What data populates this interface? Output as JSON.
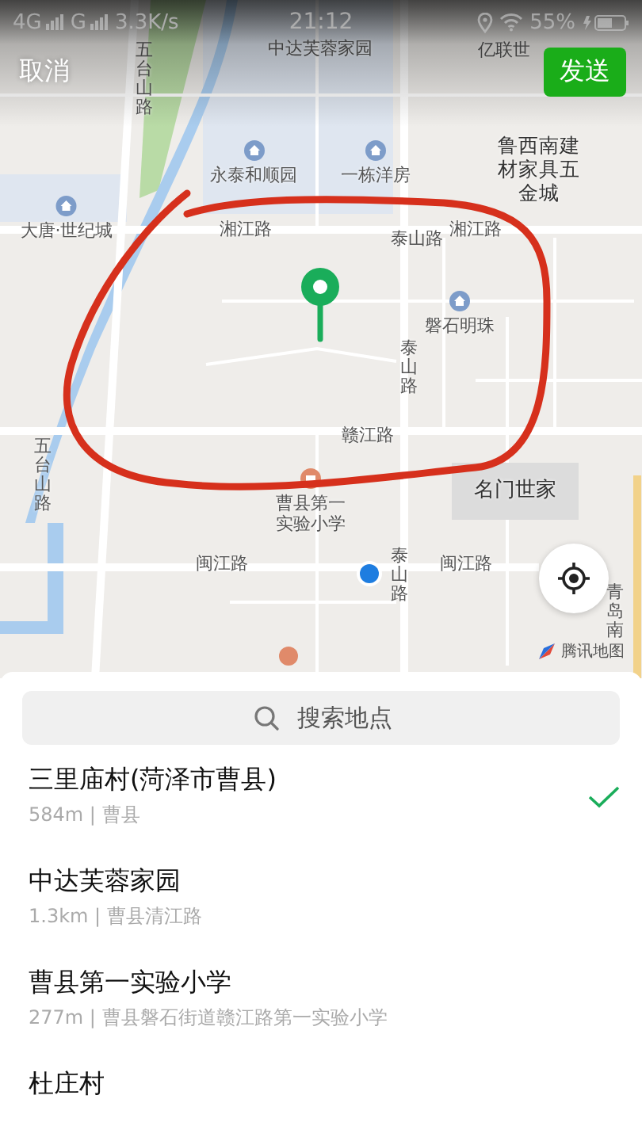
{
  "status_bar": {
    "network_1": "4G",
    "network_2": "G",
    "speed": "3.3K/s",
    "time": "21:12",
    "battery": "55%"
  },
  "top_bar": {
    "cancel": "取消",
    "send": "发送"
  },
  "map": {
    "labels": [
      {
        "text": "五台山路",
        "kind": "vroad"
      },
      {
        "text": "中达芙蓉家园",
        "kind": "road"
      },
      {
        "text": "亿联世",
        "kind": "road"
      },
      {
        "text": "永泰和顺园",
        "kind": "poi"
      },
      {
        "text": "一栋洋房",
        "kind": "poi"
      },
      {
        "text": "鲁西南建材家具五金城",
        "kind": "block"
      },
      {
        "text": "大唐·世纪城",
        "kind": "poi"
      },
      {
        "text": "湘江路",
        "kind": "road"
      },
      {
        "text": "泰山路",
        "kind": "road"
      },
      {
        "text": "湘江路",
        "kind": "road"
      },
      {
        "text": "磐石明珠",
        "kind": "poi"
      },
      {
        "text": "泰山路",
        "kind": "vroad"
      },
      {
        "text": "赣江路",
        "kind": "road"
      },
      {
        "text": "名门世家",
        "kind": "area"
      },
      {
        "text": "五台山路",
        "kind": "vroad"
      },
      {
        "text": "曹县第一实验小学",
        "kind": "school"
      },
      {
        "text": "闽江路",
        "kind": "road"
      },
      {
        "text": "泰山路",
        "kind": "vroad"
      },
      {
        "text": "闽江路",
        "kind": "road"
      },
      {
        "text": "青岛南",
        "kind": "vroad"
      }
    ],
    "provider": "腾讯地图"
  },
  "search": {
    "placeholder": "搜索地点"
  },
  "places": [
    {
      "title": "三里庙村(菏泽市曹县)",
      "detail": "584m | 曹县",
      "selected": true
    },
    {
      "title": "中达芙蓉家园",
      "detail": "1.3km | 曹县清江路",
      "selected": false
    },
    {
      "title": "曹县第一实验小学",
      "detail": "277m | 曹县磐石街道赣江路第一实验小学",
      "selected": false
    },
    {
      "title": "杜庄村",
      "selected": false
    }
  ]
}
